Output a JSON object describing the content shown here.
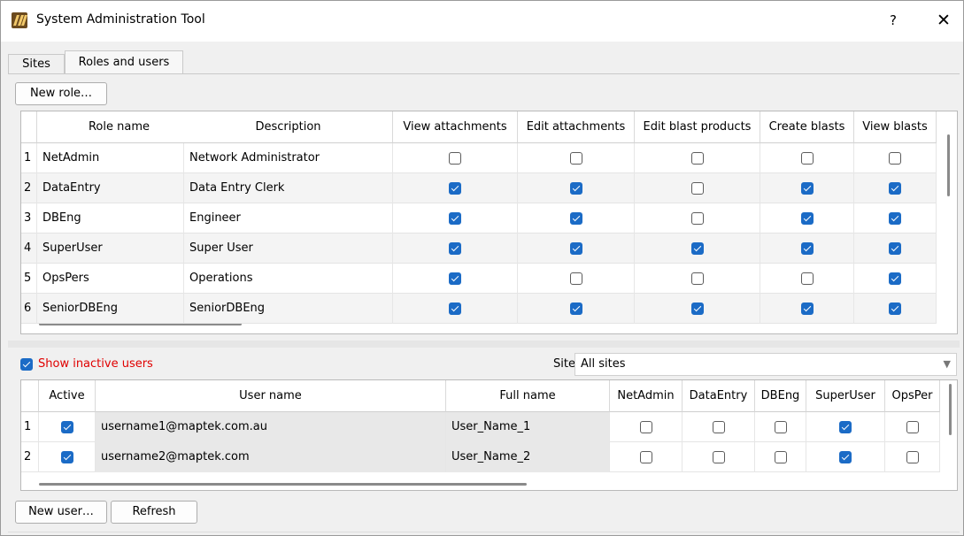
{
  "window": {
    "title": "System Administration Tool",
    "help": "?",
    "close": "✕"
  },
  "tabs": [
    {
      "label": "Sites"
    },
    {
      "label": "Roles and users"
    }
  ],
  "roles": {
    "new_button": "New role…",
    "columns": [
      "Role name",
      "Description",
      "View attachments",
      "Edit attachments",
      "Edit blast products",
      "Create blasts",
      "View blasts"
    ],
    "rows": [
      {
        "num": "1",
        "name": "NetAdmin",
        "desc": "Network Administrator",
        "perms": [
          false,
          false,
          false,
          false,
          false
        ]
      },
      {
        "num": "2",
        "name": "DataEntry",
        "desc": "Data Entry Clerk",
        "perms": [
          true,
          true,
          false,
          true,
          true
        ]
      },
      {
        "num": "3",
        "name": "DBEng",
        "desc": "Engineer",
        "perms": [
          true,
          true,
          false,
          true,
          true
        ]
      },
      {
        "num": "4",
        "name": "SuperUser",
        "desc": "Super User",
        "perms": [
          true,
          true,
          true,
          true,
          true
        ]
      },
      {
        "num": "5",
        "name": "OpsPers",
        "desc": "Operations",
        "perms": [
          true,
          false,
          false,
          false,
          true
        ]
      },
      {
        "num": "6",
        "name": "SeniorDBEng",
        "desc": "SeniorDBEng",
        "perms": [
          true,
          true,
          true,
          true,
          true
        ]
      }
    ]
  },
  "users": {
    "show_inactive_label": "Show inactive users",
    "show_inactive_checked": true,
    "site_label": "Site",
    "site_value": "All sites",
    "columns": [
      "Active",
      "User name",
      "Full name",
      "NetAdmin",
      "DataEntry",
      "DBEng",
      "SuperUser",
      "OpsPer"
    ],
    "sort_indicator": "^",
    "rows": [
      {
        "num": "1",
        "active": true,
        "username": "username1@maptek.com.au",
        "fullname": "User_Name_1",
        "roles": [
          false,
          false,
          false,
          true,
          false
        ]
      },
      {
        "num": "2",
        "active": true,
        "username": "username2@maptek.com",
        "fullname": "User_Name_2",
        "roles": [
          false,
          false,
          false,
          true,
          false
        ]
      }
    ],
    "new_button": "New user…",
    "refresh_button": "Refresh"
  },
  "colors": {
    "accent": "#1b6bc6",
    "warning_text": "#e00000"
  }
}
